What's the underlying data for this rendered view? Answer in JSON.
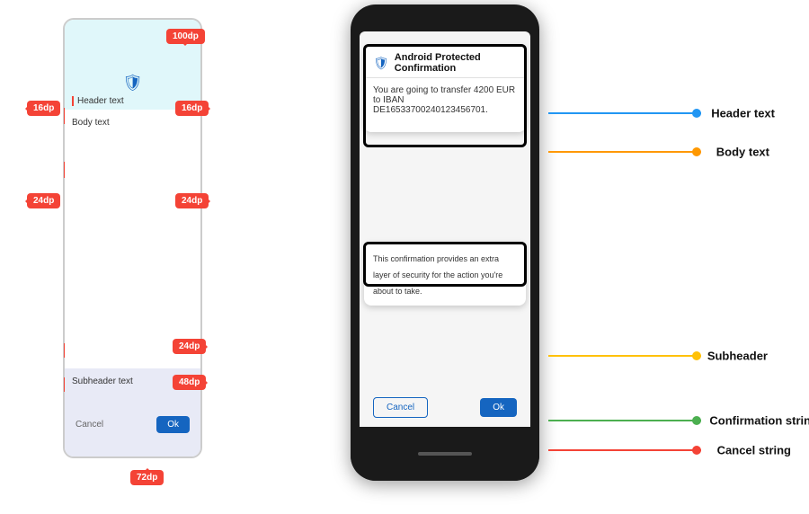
{
  "left": {
    "badges": {
      "top_100": "100dp",
      "left_16": "16dp",
      "right_16": "16dp",
      "left_24": "24dp",
      "right_24": "24dp",
      "bottom_24": "24dp",
      "bottom_48": "48dp",
      "bottom_72": "72dp"
    },
    "labels": {
      "header_text": "Header text",
      "body_text": "Body text",
      "subheader_text": "Subheader text",
      "cancel": "Cancel",
      "ok": "Ok"
    }
  },
  "right": {
    "dialog": {
      "title": "Android Protected Confirmation",
      "body": "You are going to transfer 4200 EUR to IBAN DE16533700240123456701.",
      "security_text": "This confirmation provides an extra layer of security for the action you're about to take.",
      "cancel": "Cancel",
      "ok": "Ok"
    },
    "annotations": {
      "header_text": "Header text",
      "body_text": "Body text",
      "subheader": "Subheader",
      "confirmation_string": "Confirmation string",
      "cancel_string": "Cancel string"
    }
  }
}
